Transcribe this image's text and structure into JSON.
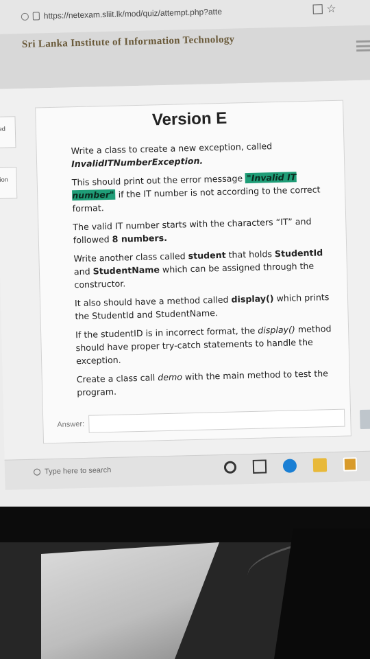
{
  "browser": {
    "url": "https://netexam.sliit.lk/mod/quiz/attempt.php?atte"
  },
  "site": {
    "name": "Sri Lanka Institute of Information Technology"
  },
  "sidebar": {
    "stub1": "ed",
    "stub2": "ion"
  },
  "question": {
    "title": "Version E",
    "p1_text": "Write a class to create a new exception, called ",
    "p1_bold": "InvalidITNumberException.",
    "p2_text_before": "This should print out the error message ",
    "p2_highlight": "\"Invalid IT number\"",
    "p2_text_after": " if the IT number is not according to the correct format.",
    "p3_text": "The valid IT number starts with the characters “IT” and followed ",
    "p3_bold": "8 numbers.",
    "p4_text1": "Write another class called ",
    "p4_bold1": "student",
    "p4_text2": " that holds ",
    "p4_bold2": "StudentId",
    "p4_text3": " and ",
    "p4_bold3": "StudentName",
    "p4_text4": " which can be assigned through the constructor.",
    "p5_text1": "It also should have a method called ",
    "p5_bold": "display()",
    "p5_text2": " which prints the StudentId and StudentName.",
    "p6_text1": "If the studentID is in incorrect format, the ",
    "p6_italic": "display()",
    "p6_text2": " method should have proper try-catch statements to handle the exception.",
    "p7_text1": "Create a class call ",
    "p7_italic": "demo",
    "p7_text2": " with the main method to test the program.",
    "answer_label": "Answer:",
    "answer_value": ""
  },
  "taskbar": {
    "search_placeholder": "Type here to search"
  }
}
